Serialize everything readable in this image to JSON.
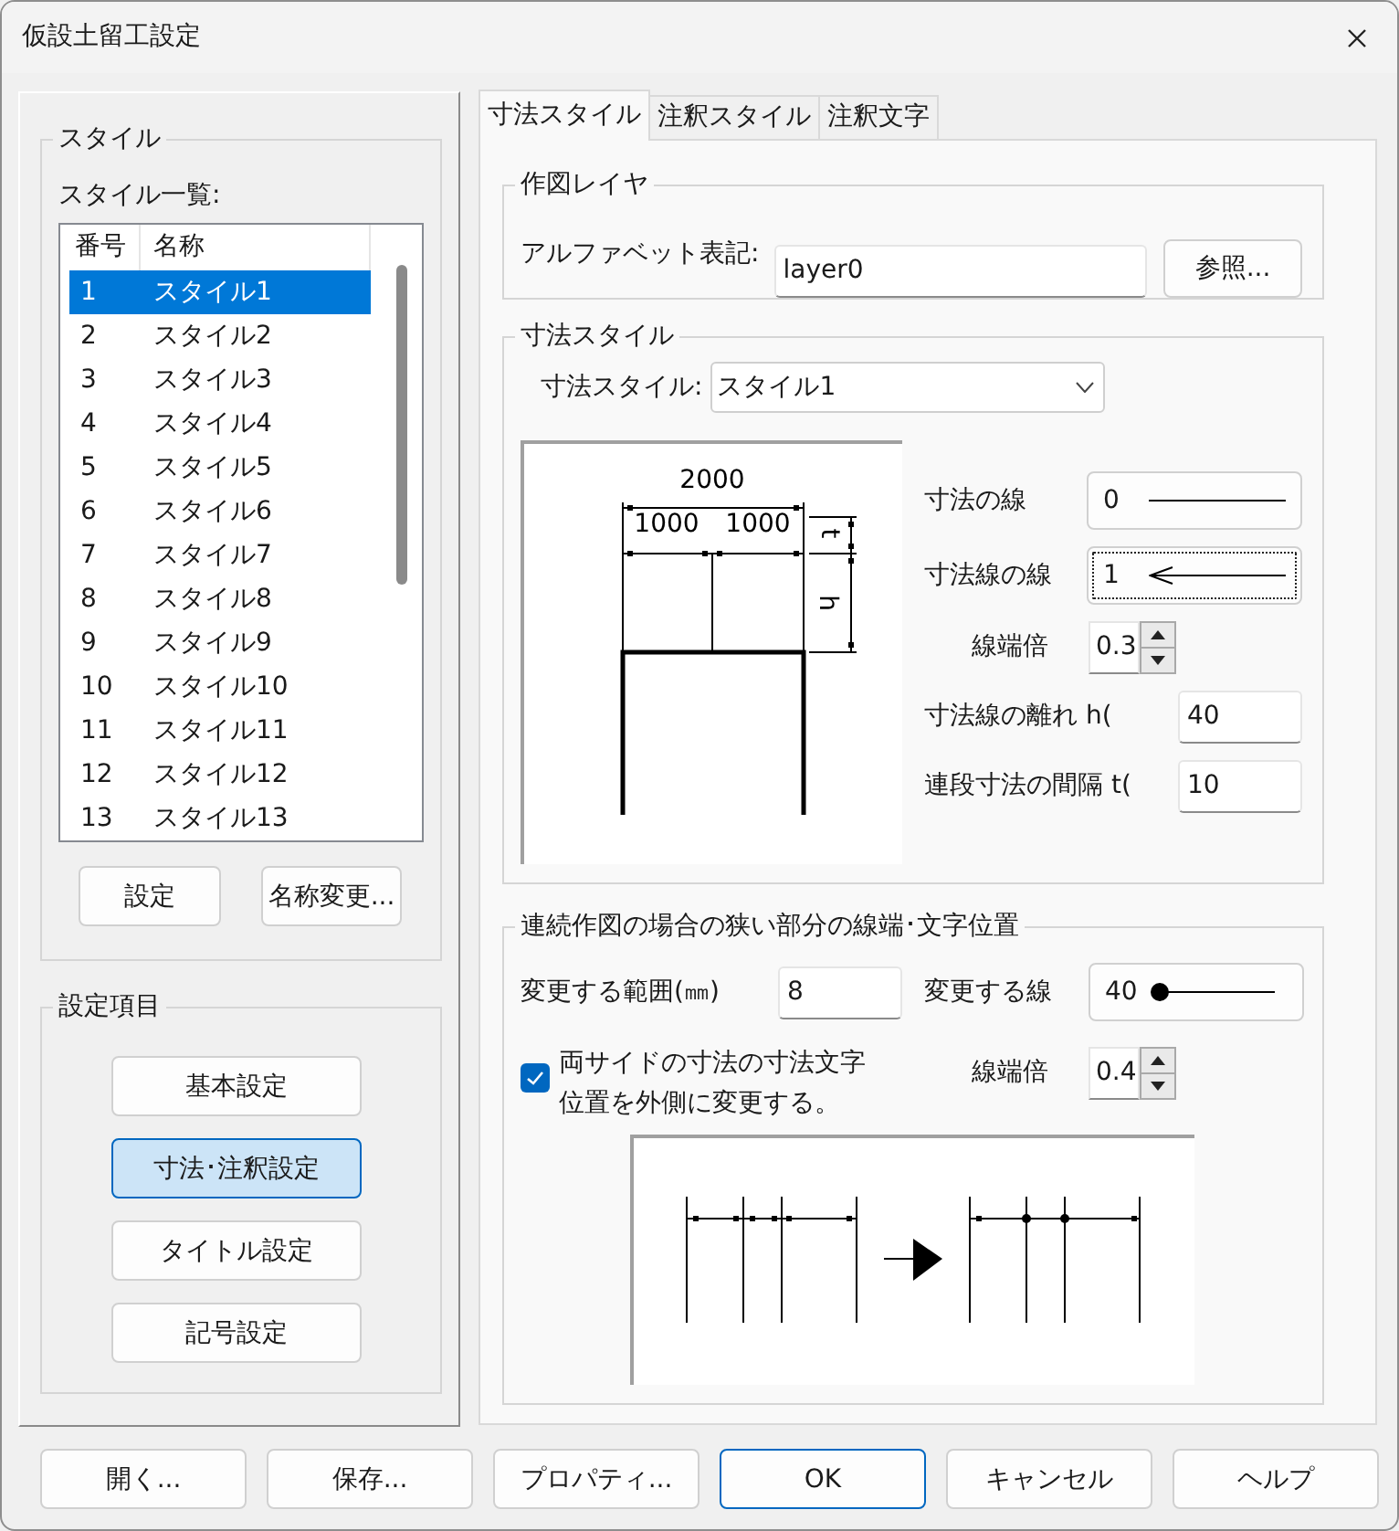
{
  "window": {
    "title": "仮設土留工設定"
  },
  "style_group": {
    "title": "スタイル",
    "list_label": "スタイル一覧:",
    "columns": [
      "番号",
      "名称"
    ],
    "rows": [
      {
        "number": "1",
        "name": "スタイル1",
        "selected": true
      },
      {
        "number": "2",
        "name": "スタイル2",
        "selected": false
      },
      {
        "number": "3",
        "name": "スタイル3",
        "selected": false
      },
      {
        "number": "4",
        "name": "スタイル4",
        "selected": false
      },
      {
        "number": "5",
        "name": "スタイル5",
        "selected": false
      },
      {
        "number": "6",
        "name": "スタイル6",
        "selected": false
      },
      {
        "number": "7",
        "name": "スタイル7",
        "selected": false
      },
      {
        "number": "8",
        "name": "スタイル8",
        "selected": false
      },
      {
        "number": "9",
        "name": "スタイル9",
        "selected": false
      },
      {
        "number": "10",
        "name": "スタイル10",
        "selected": false
      },
      {
        "number": "11",
        "name": "スタイル11",
        "selected": false
      },
      {
        "number": "12",
        "name": "スタイル12",
        "selected": false
      },
      {
        "number": "13",
        "name": "スタイル13",
        "selected": false
      }
    ],
    "buttons": [
      "設定",
      "名称変更..."
    ]
  },
  "settings_group": {
    "title": "設定項目",
    "buttons": [
      {
        "label": "基本設定",
        "selected": false
      },
      {
        "label": "寸法･注釈設定",
        "selected": true
      },
      {
        "label": "タイトル設定",
        "selected": false
      },
      {
        "label": "記号設定",
        "selected": false
      }
    ]
  },
  "tabs": [
    {
      "label": "寸法スタイル",
      "selected": true
    },
    {
      "label": "注釈スタイル",
      "selected": false
    },
    {
      "label": "注釈文字",
      "selected": false
    }
  ],
  "layer_group": {
    "title": "作図レイヤ",
    "field_label": "アルファベット表記:",
    "value": "layer0",
    "button": "参照..."
  },
  "dimension_group": {
    "title": "寸法スタイル",
    "style_label": "寸法スタイル:",
    "style_value": "スタイル1",
    "diagram": {
      "total": "2000",
      "parts": [
        "1000",
        "1000"
      ],
      "t_label": "t",
      "h_label": "h"
    },
    "fields": [
      {
        "kind": "line",
        "label": "寸法の線",
        "line": {
          "kind": "plain",
          "value": "0",
          "focused": false
        }
      },
      {
        "kind": "line",
        "label": "寸法線の線",
        "line": {
          "kind": "arrow",
          "value": "1",
          "focused": true
        }
      },
      {
        "kind": "spin",
        "label": "線端倍",
        "value": "0.3"
      },
      {
        "kind": "text",
        "label": "寸法線の離れ h(",
        "value": "40"
      },
      {
        "kind": "text",
        "label": "連段寸法の間隔 t(",
        "value": "10"
      }
    ]
  },
  "narrow_group": {
    "title": "連続作図の場合の狭い部分の線端･文字位置",
    "range_label": "変更する範囲(㎜)",
    "range_value": "8",
    "line_label": "変更する線",
    "line": {
      "kind": "dot",
      "value": "40",
      "focused": false
    },
    "option": {
      "label": "両サイドの寸法の寸法文字位置を外側に変更する。",
      "checked": true
    },
    "spin_label": "線端倍",
    "spin_value": "0.4"
  },
  "buttons": [
    {
      "label": "開く...",
      "default": false
    },
    {
      "label": "保存...",
      "default": false
    },
    {
      "label": "プロパティ...",
      "default": false
    },
    {
      "label": "OK",
      "default": true
    },
    {
      "label": "キャンセル",
      "default": false
    },
    {
      "label": "ヘルプ",
      "default": false
    }
  ]
}
